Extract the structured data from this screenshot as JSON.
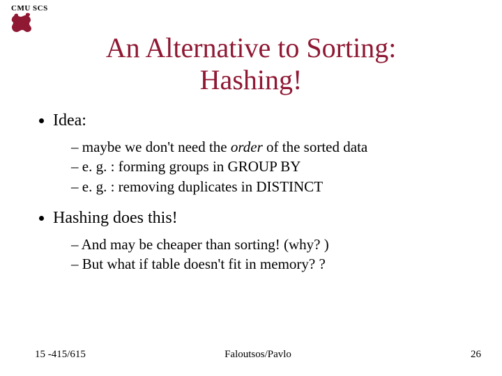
{
  "header": {
    "label": "CMU SCS"
  },
  "title": {
    "line1": "An Alternative to Sorting:",
    "line2": "Hashing!"
  },
  "bullets": {
    "b1": {
      "label": "Idea:"
    },
    "b1_sub": {
      "s1_pre": "maybe we don't need the ",
      "s1_em": "order",
      "s1_post": " of the sorted data",
      "s2": "e. g. : forming groups in GROUP BY",
      "s3": "e. g. : removing duplicates in DISTINCT"
    },
    "b2": {
      "label": "Hashing does this!"
    },
    "b2_sub": {
      "s1": "And may be cheaper than sorting!  (why? )",
      "s2": "But what if table doesn't fit in memory? ?"
    }
  },
  "footer": {
    "left": "15 -415/615",
    "center": "Faloutsos/Pavlo",
    "right": "26"
  },
  "colors": {
    "accent": "#8f1833"
  }
}
